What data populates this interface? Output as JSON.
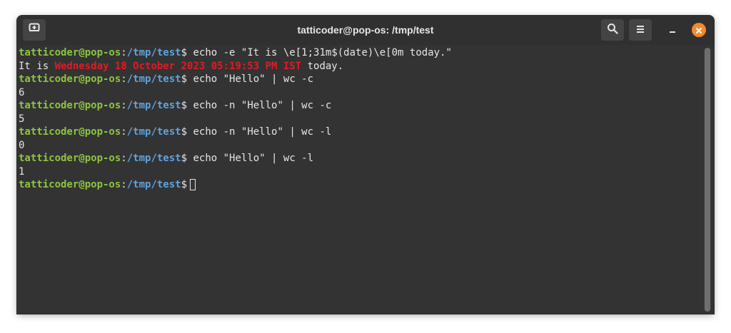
{
  "window": {
    "title": "tatticoder@pop-os: /tmp/test"
  },
  "colors": {
    "user": "#8cc63f",
    "path": "#5fa2dd",
    "error": "#e01b24",
    "text": "#e6e6e6",
    "close": "#f6892c"
  },
  "icons": {
    "new_tab": "new-tab-icon",
    "search": "search-icon",
    "menu": "hamburger-menu-icon",
    "minimize": "minimize-icon",
    "close": "close-icon"
  },
  "terminal": {
    "prompt": {
      "user": "tatticoder@pop-os",
      "sep": ":",
      "path": "/tmp/test",
      "symbol": "$"
    },
    "lines": [
      {
        "type": "cmd",
        "cmd": " echo -e \"It is \\e[1;31m$(date)\\e[0m today.\""
      },
      {
        "type": "out_red",
        "pre": "It is ",
        "red": "Wednesday 18 October 2023 05:19:53 PM IST",
        "post": " today."
      },
      {
        "type": "cmd",
        "cmd": " echo \"Hello\" | wc -c"
      },
      {
        "type": "out",
        "text": "6"
      },
      {
        "type": "cmd",
        "cmd": " echo -n \"Hello\" | wc -c"
      },
      {
        "type": "out",
        "text": "5"
      },
      {
        "type": "cmd",
        "cmd": " echo -n \"Hello\" | wc -l"
      },
      {
        "type": "out",
        "text": "0"
      },
      {
        "type": "cmd",
        "cmd": " echo \"Hello\" | wc -l"
      },
      {
        "type": "out",
        "text": "1"
      },
      {
        "type": "prompt"
      }
    ]
  }
}
